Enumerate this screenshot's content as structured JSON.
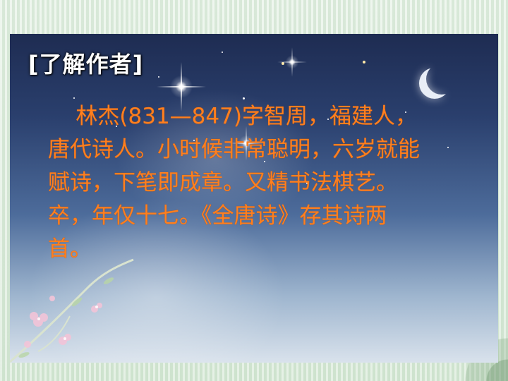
{
  "slide": {
    "heading": "[了解作者]",
    "body": "    林杰(831—847)字智周，福建人，唐代诗人。小时候非常聪明，六岁就能赋诗，下笔即成章。又精书法棋艺。卒，年仅十七。《全唐诗》存其诗两首。"
  },
  "colors": {
    "heading": "#ffffff",
    "body_text": "#ff7f1e",
    "frame": "#dfeede",
    "sky_top": "#1e2c52"
  },
  "icons": [
    "moon-icon",
    "star-glint-icon",
    "flower-branch-icon"
  ]
}
